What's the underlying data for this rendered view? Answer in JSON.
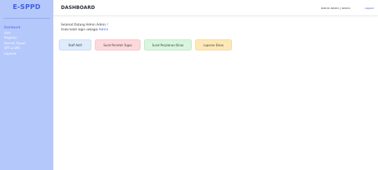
{
  "app": {
    "brand": "E-SPPD"
  },
  "sidebar": {
    "items": [
      {
        "label": "Dashboard",
        "active": true
      },
      {
        "label": "User",
        "active": false
      },
      {
        "label": "Pegawai",
        "active": false
      },
      {
        "label": "Daerah Tujuan",
        "active": false
      },
      {
        "label": "SPT & SPD",
        "active": false
      },
      {
        "label": "Laporan",
        "active": false
      }
    ]
  },
  "header": {
    "title": "DASHBOARD",
    "user_info": "Admin Admin | Admin",
    "logout_label": "Logout"
  },
  "main": {
    "welcome": "Selamat Datang Admin Admin !",
    "login_prefix": "Anda telah login sebagai",
    "login_role": "Admin",
    "cards": [
      {
        "label": "Staff Aktif",
        "color": "#deecfb"
      },
      {
        "label": "Surat Perintah Tugas",
        "color": "#fdd9dc"
      },
      {
        "label": "Surat Perjalanan Dinas",
        "color": "#d8f6dd"
      },
      {
        "label": "Laporan Dinas",
        "color": "#fde8b8"
      }
    ]
  },
  "colors": {
    "sidebar_bg": "#b5c8fb",
    "accent": "#3f5fe8"
  }
}
